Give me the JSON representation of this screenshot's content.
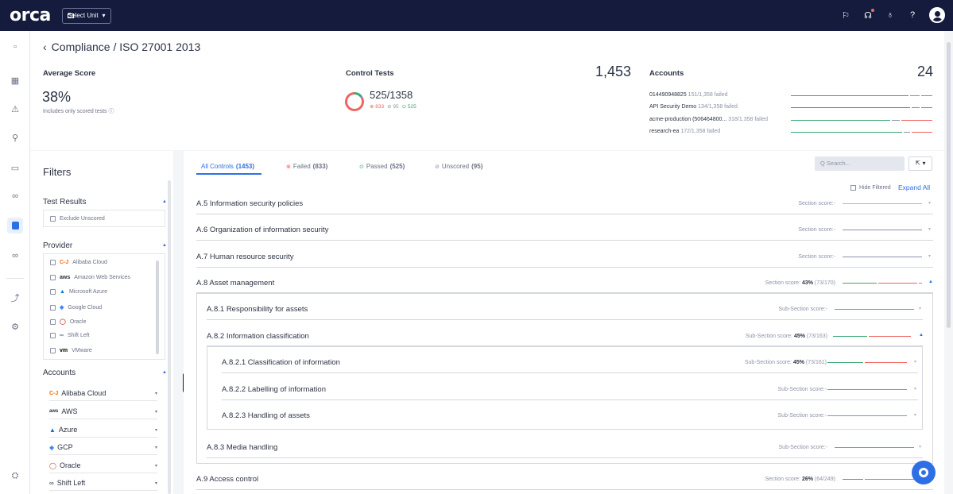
{
  "topbar": {
    "logo": "orca",
    "unit_select": "Select Unit",
    "unit_caret": "▾",
    "icons": [
      "flag-icon",
      "megaphone-icon",
      "bell-icon",
      "help-icon",
      "user-avatar"
    ],
    "icon_glyphs": [
      "⚐",
      "☊",
      "♁",
      "?"
    ]
  },
  "rail": {
    "icons": [
      "dashboard-icon",
      "inventory-icon",
      "alerts-icon",
      "search-icon",
      "vulnerabilities-icon",
      "graph-icon",
      "compliance-icon",
      "shift-left-icon",
      "integrations-icon",
      "settings-icon",
      "user-settings-icon"
    ],
    "glyphs": [
      "▫",
      "▦",
      "⚠",
      "⚲",
      "▭",
      "∞",
      "",
      "∞",
      "⤴",
      "⚙",
      "⛭"
    ]
  },
  "header": {
    "back": "‹",
    "breadcrumb": "Compliance / ISO 27001 2013",
    "average_score_label": "Average Score",
    "average_score": "38%",
    "average_note": "Includes only scored tests ⓘ",
    "control_tests_label": "Control Tests",
    "control_tests_total": "1,453",
    "control_tests_value": "525/1358",
    "control_tests_breakdown": {
      "failed": "⊗ 833",
      "unscored": "⊘ 95",
      "passed": "⊙ 525"
    },
    "accounts_label": "Accounts",
    "accounts_total": "24",
    "accounts": [
      {
        "name": "014490948825",
        "detail": "151/1,358 failed"
      },
      {
        "name": "API Security Demo",
        "detail": "134/1,358 failed"
      },
      {
        "name": "acme-production (506464800...",
        "detail": "318/1,358 failed"
      },
      {
        "name": "research-ea",
        "detail": "172/1,358 failed"
      }
    ]
  },
  "filters": {
    "title": "Filters",
    "test_results_label": "Test Results",
    "exclude_unscored": "Exclude Unscored",
    "provider_label": "Provider",
    "providers": [
      {
        "logo": "C-J",
        "name": "Alibaba Cloud",
        "color": "#ff6a00"
      },
      {
        "logo": "aws",
        "name": "Amazon Web Services",
        "color": "#232f3e"
      },
      {
        "logo": "▲",
        "name": "Microsoft Azure",
        "color": "#0078d4"
      },
      {
        "logo": "◆",
        "name": "Google Cloud",
        "color": "#4285f4"
      },
      {
        "logo": "◯",
        "name": "Oracle",
        "color": "#c74634"
      },
      {
        "logo": "∞",
        "name": "Shift Left",
        "color": "#2c3345"
      },
      {
        "logo": "vm",
        "name": "VMware",
        "color": "#2c3345"
      }
    ],
    "accounts_label": "Accounts",
    "accounts": [
      {
        "logo": "C-J",
        "name": "Alibaba Cloud",
        "color": "#ff6a00"
      },
      {
        "logo": "aws",
        "name": "AWS",
        "color": "#232f3e"
      },
      {
        "logo": "▲",
        "name": "Azure",
        "color": "#0078d4"
      },
      {
        "logo": "◆",
        "name": "GCP",
        "color": "#4285f4"
      },
      {
        "logo": "◯",
        "name": "Oracle",
        "color": "#c74634"
      },
      {
        "logo": "∞",
        "name": "Shift Left",
        "color": "#2c3345"
      }
    ],
    "caret_up": "▲",
    "caret_down": "▾"
  },
  "tabs": [
    {
      "icon": "",
      "label": "All Controls",
      "count": "(1453)",
      "icon_name": "all-icon"
    },
    {
      "icon": "⊗",
      "label": "Failed",
      "count": "(833)",
      "icon_name": "failed-icon",
      "color": "#ef6461"
    },
    {
      "icon": "⊙",
      "label": "Passed",
      "count": "(525)",
      "icon_name": "passed-icon",
      "color": "#3aa776"
    },
    {
      "icon": "⊘",
      "label": "Unscored",
      "count": "(95)",
      "icon_name": "unscored-icon",
      "color": "#8c93a8"
    }
  ],
  "toolbar": {
    "search_placeholder": "Q Search...",
    "export": "⇱ ▾",
    "hide_filtered": "Hide Filtered",
    "expand_all": "Expand All"
  },
  "controls": {
    "a5": {
      "name": "A.5 Information security policies",
      "score": "Section score:-"
    },
    "a6": {
      "name": "A.6 Organization of information security",
      "score": "Section score:-"
    },
    "a7": {
      "name": "A.7 Human resource security",
      "score": "Section score:-"
    },
    "a8": {
      "name": "A.8 Asset management",
      "score_prefix": "Section score: ",
      "score_pct": "43%",
      "score_detail": " (73/170)",
      "passed": 73,
      "total": 170
    },
    "a81": {
      "name": "A.8.1 Responsibility for assets",
      "score": "Sub-Section score:-"
    },
    "a82": {
      "name": "A.8.2 Information classification",
      "score_prefix": "Sub-Section score: ",
      "score_pct": "45%",
      "score_detail": " (73/163)",
      "passed": 73,
      "total": 163
    },
    "a821": {
      "name": "A.8.2.1 Classification of information",
      "score_prefix": "Sub-Section score: ",
      "score_pct": "45%",
      "score_detail": " (73/161)",
      "passed": 73,
      "total": 161
    },
    "a822": {
      "name": "A.8.2.2 Labelling of information",
      "score": "Sub-Section score:-"
    },
    "a823": {
      "name": "A.8.2.3 Handling of assets",
      "score": "Sub-Section score:-"
    },
    "a83": {
      "name": "A.8.3 Media handling",
      "score": "Sub-Section score:-"
    },
    "a9": {
      "name": "A.9 Access control",
      "score_prefix": "Section score: ",
      "score_pct": "26%",
      "score_detail": " (64/249)",
      "passed": 64,
      "total": 249
    }
  },
  "colors": {
    "accent": "#2f6fe6",
    "pass": "#3aa776",
    "fail": "#ef6461",
    "unscored": "#8c93a8",
    "topbar": "#141b3d"
  }
}
